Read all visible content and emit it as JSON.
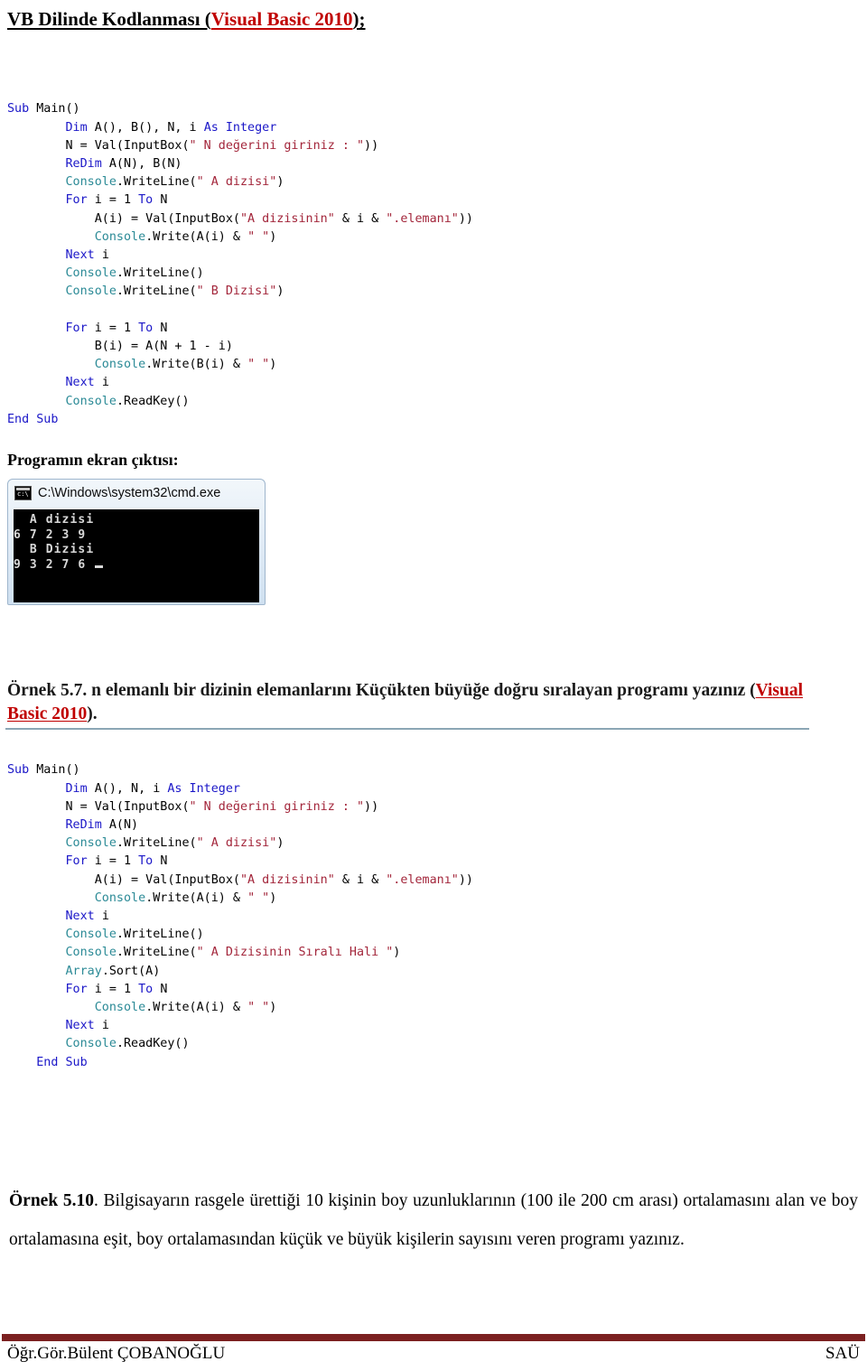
{
  "heading": {
    "text_black": "VB Dilinde Kodlanması (",
    "text_red": "Visual Basic 2010",
    "text_tail": ");"
  },
  "code_block_1": {
    "lines": [
      [
        {
          "t": "Sub ",
          "c": "kw"
        },
        {
          "t": "Main()",
          "c": "pln"
        }
      ],
      [
        {
          "t": "        ",
          "c": "pln"
        },
        {
          "t": "Dim ",
          "c": "kw"
        },
        {
          "t": "A(), B(), N, i ",
          "c": "pln"
        },
        {
          "t": "As Integer",
          "c": "kw"
        }
      ],
      [
        {
          "t": "        N = Val(InputBox(",
          "c": "pln"
        },
        {
          "t": "\" N değerini giriniz : \"",
          "c": "str"
        },
        {
          "t": "))",
          "c": "pln"
        }
      ],
      [
        {
          "t": "        ",
          "c": "pln"
        },
        {
          "t": "ReDim ",
          "c": "kw"
        },
        {
          "t": "A(N), B(N)",
          "c": "pln"
        }
      ],
      [
        {
          "t": "        ",
          "c": "pln"
        },
        {
          "t": "Console",
          "c": "cls"
        },
        {
          "t": ".WriteLine(",
          "c": "pln"
        },
        {
          "t": "\" A dizisi\"",
          "c": "str"
        },
        {
          "t": ")",
          "c": "pln"
        }
      ],
      [
        {
          "t": "        ",
          "c": "pln"
        },
        {
          "t": "For ",
          "c": "kw"
        },
        {
          "t": "i = 1 ",
          "c": "pln"
        },
        {
          "t": "To ",
          "c": "kw"
        },
        {
          "t": "N",
          "c": "pln"
        }
      ],
      [
        {
          "t": "            A(i) = Val(InputBox(",
          "c": "pln"
        },
        {
          "t": "\"A dizisinin\"",
          "c": "str"
        },
        {
          "t": " & i & ",
          "c": "pln"
        },
        {
          "t": "\".elemanı\"",
          "c": "str"
        },
        {
          "t": "))",
          "c": "pln"
        }
      ],
      [
        {
          "t": "            ",
          "c": "pln"
        },
        {
          "t": "Console",
          "c": "cls"
        },
        {
          "t": ".Write(A(i) & ",
          "c": "pln"
        },
        {
          "t": "\" \"",
          "c": "str"
        },
        {
          "t": ")",
          "c": "pln"
        }
      ],
      [
        {
          "t": "        ",
          "c": "pln"
        },
        {
          "t": "Next ",
          "c": "kw"
        },
        {
          "t": "i",
          "c": "pln"
        }
      ],
      [
        {
          "t": "        ",
          "c": "pln"
        },
        {
          "t": "Console",
          "c": "cls"
        },
        {
          "t": ".WriteLine()",
          "c": "pln"
        }
      ],
      [
        {
          "t": "        ",
          "c": "pln"
        },
        {
          "t": "Console",
          "c": "cls"
        },
        {
          "t": ".WriteLine(",
          "c": "pln"
        },
        {
          "t": "\" B Dizisi\"",
          "c": "str"
        },
        {
          "t": ")",
          "c": "pln"
        }
      ],
      [
        {
          "t": "",
          "c": "pln"
        }
      ],
      [
        {
          "t": "        ",
          "c": "pln"
        },
        {
          "t": "For ",
          "c": "kw"
        },
        {
          "t": "i = 1 ",
          "c": "pln"
        },
        {
          "t": "To ",
          "c": "kw"
        },
        {
          "t": "N",
          "c": "pln"
        }
      ],
      [
        {
          "t": "            B(i) = A(N + 1 - i)",
          "c": "pln"
        }
      ],
      [
        {
          "t": "            ",
          "c": "pln"
        },
        {
          "t": "Console",
          "c": "cls"
        },
        {
          "t": ".Write(B(i) & ",
          "c": "pln"
        },
        {
          "t": "\" \"",
          "c": "str"
        },
        {
          "t": ")",
          "c": "pln"
        }
      ],
      [
        {
          "t": "        ",
          "c": "pln"
        },
        {
          "t": "Next ",
          "c": "kw"
        },
        {
          "t": "i",
          "c": "pln"
        }
      ],
      [
        {
          "t": "        ",
          "c": "pln"
        },
        {
          "t": "Console",
          "c": "cls"
        },
        {
          "t": ".ReadKey()",
          "c": "pln"
        }
      ],
      [
        {
          "t": "End Sub",
          "c": "kw"
        }
      ]
    ]
  },
  "output_label": "Programın ekran çıktısı:",
  "console": {
    "title": "C:\\Windows\\system32\\cmd.exe",
    "icon": "cmd-icon",
    "lines": [
      "  A dizisi",
      "6 7 2 3 9",
      "  B Dizisi",
      "9 3 2 7 6"
    ]
  },
  "exercise_57": {
    "label": "Örnek 5.7.",
    "text": " n elemanlı bir dizinin elemanlarını Küçükten büyüğe doğru sıralayan programı yazınız (",
    "vb_ref": "Visual Basic 2010",
    "tail": ")."
  },
  "code_block_2": {
    "lines": [
      [
        {
          "t": "Sub ",
          "c": "kw"
        },
        {
          "t": "Main()",
          "c": "pln"
        }
      ],
      [
        {
          "t": "        ",
          "c": "pln"
        },
        {
          "t": "Dim ",
          "c": "kw"
        },
        {
          "t": "A(), N, i ",
          "c": "pln"
        },
        {
          "t": "As Integer",
          "c": "kw"
        }
      ],
      [
        {
          "t": "        N = Val(InputBox(",
          "c": "pln"
        },
        {
          "t": "\" N değerini giriniz : \"",
          "c": "str"
        },
        {
          "t": "))",
          "c": "pln"
        }
      ],
      [
        {
          "t": "        ",
          "c": "pln"
        },
        {
          "t": "ReDim ",
          "c": "kw"
        },
        {
          "t": "A(N)",
          "c": "pln"
        }
      ],
      [
        {
          "t": "        ",
          "c": "pln"
        },
        {
          "t": "Console",
          "c": "cls"
        },
        {
          "t": ".WriteLine(",
          "c": "pln"
        },
        {
          "t": "\" A dizisi\"",
          "c": "str"
        },
        {
          "t": ")",
          "c": "pln"
        }
      ],
      [
        {
          "t": "        ",
          "c": "pln"
        },
        {
          "t": "For ",
          "c": "kw"
        },
        {
          "t": "i = 1 ",
          "c": "pln"
        },
        {
          "t": "To ",
          "c": "kw"
        },
        {
          "t": "N",
          "c": "pln"
        }
      ],
      [
        {
          "t": "            A(i) = Val(InputBox(",
          "c": "pln"
        },
        {
          "t": "\"A dizisinin\"",
          "c": "str"
        },
        {
          "t": " & i & ",
          "c": "pln"
        },
        {
          "t": "\".elemanı\"",
          "c": "str"
        },
        {
          "t": "))",
          "c": "pln"
        }
      ],
      [
        {
          "t": "            ",
          "c": "pln"
        },
        {
          "t": "Console",
          "c": "cls"
        },
        {
          "t": ".Write(A(i) & ",
          "c": "pln"
        },
        {
          "t": "\" \"",
          "c": "str"
        },
        {
          "t": ")",
          "c": "pln"
        }
      ],
      [
        {
          "t": "        ",
          "c": "pln"
        },
        {
          "t": "Next ",
          "c": "kw"
        },
        {
          "t": "i",
          "c": "pln"
        }
      ],
      [
        {
          "t": "        ",
          "c": "pln"
        },
        {
          "t": "Console",
          "c": "cls"
        },
        {
          "t": ".WriteLine()",
          "c": "pln"
        }
      ],
      [
        {
          "t": "        ",
          "c": "pln"
        },
        {
          "t": "Console",
          "c": "cls"
        },
        {
          "t": ".WriteLine(",
          "c": "pln"
        },
        {
          "t": "\" A Dizisinin Sıralı Hali \"",
          "c": "str"
        },
        {
          "t": ")",
          "c": "pln"
        }
      ],
      [
        {
          "t": "        ",
          "c": "pln"
        },
        {
          "t": "Array",
          "c": "cls"
        },
        {
          "t": ".Sort(A)",
          "c": "pln"
        }
      ],
      [
        {
          "t": "        ",
          "c": "pln"
        },
        {
          "t": "For ",
          "c": "kw"
        },
        {
          "t": "i = 1 ",
          "c": "pln"
        },
        {
          "t": "To ",
          "c": "kw"
        },
        {
          "t": "N",
          "c": "pln"
        }
      ],
      [
        {
          "t": "            ",
          "c": "pln"
        },
        {
          "t": "Console",
          "c": "cls"
        },
        {
          "t": ".Write(A(i) & ",
          "c": "pln"
        },
        {
          "t": "\" \"",
          "c": "str"
        },
        {
          "t": ")",
          "c": "pln"
        }
      ],
      [
        {
          "t": "        ",
          "c": "pln"
        },
        {
          "t": "Next ",
          "c": "kw"
        },
        {
          "t": "i",
          "c": "pln"
        }
      ],
      [
        {
          "t": "        ",
          "c": "pln"
        },
        {
          "t": "Console",
          "c": "cls"
        },
        {
          "t": ".ReadKey()",
          "c": "pln"
        }
      ],
      [
        {
          "t": "    ",
          "c": "pln"
        },
        {
          "t": "End Sub",
          "c": "kw"
        }
      ]
    ]
  },
  "exercise_510": {
    "label": "Örnek 5.10",
    "text": ". Bilgisayarın rasgele ürettiği 10 kişinin boy uzunluklarının (100 ile 200 cm arası) ortalamasını alan ve boy ortalamasına eşit, boy ortalamasından küçük ve büyük kişilerin sayısını veren programı yazınız."
  },
  "footer": {
    "left": "Öğr.Gör.Bülent ÇOBANOĞLU",
    "right": "SAÜ"
  },
  "colors": {
    "keyword": "#1b17c8",
    "class": "#2b8a96",
    "string": "#a3263b",
    "accent_red": "#c00000",
    "footer_rule": "#7b2020",
    "section_rule": "#8ba6b5"
  }
}
